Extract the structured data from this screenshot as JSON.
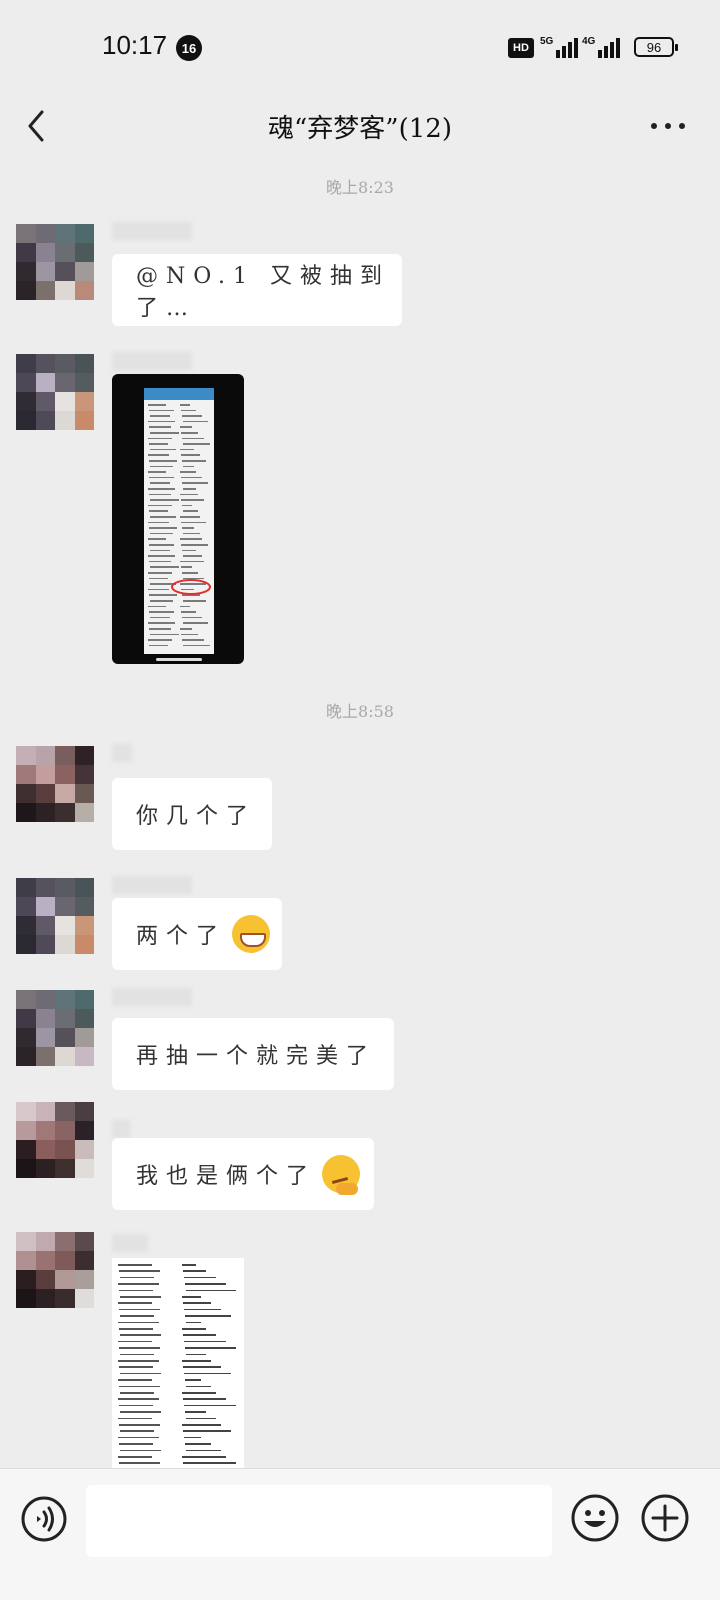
{
  "status_bar": {
    "time": "10:17",
    "notification_count": "16",
    "hd_label": "HD",
    "net1_label": "5G",
    "net2_label": "4G",
    "battery": "96"
  },
  "header": {
    "title": "魂“弃梦客”(12)"
  },
  "messages": {
    "ts1": "晚上8:23",
    "m1": "@NO.1 又被抽到了…",
    "ts2": "晚上8:58",
    "m3": "你几个了",
    "m4": "两个了",
    "m5": "再抽一个就完美了",
    "m6": "我也是俩个了"
  },
  "icons": {
    "back": "back-arrow-icon",
    "more": "more-icon",
    "voice": "voice-icon",
    "emoji": "emoji-icon",
    "plus": "plus-icon"
  }
}
